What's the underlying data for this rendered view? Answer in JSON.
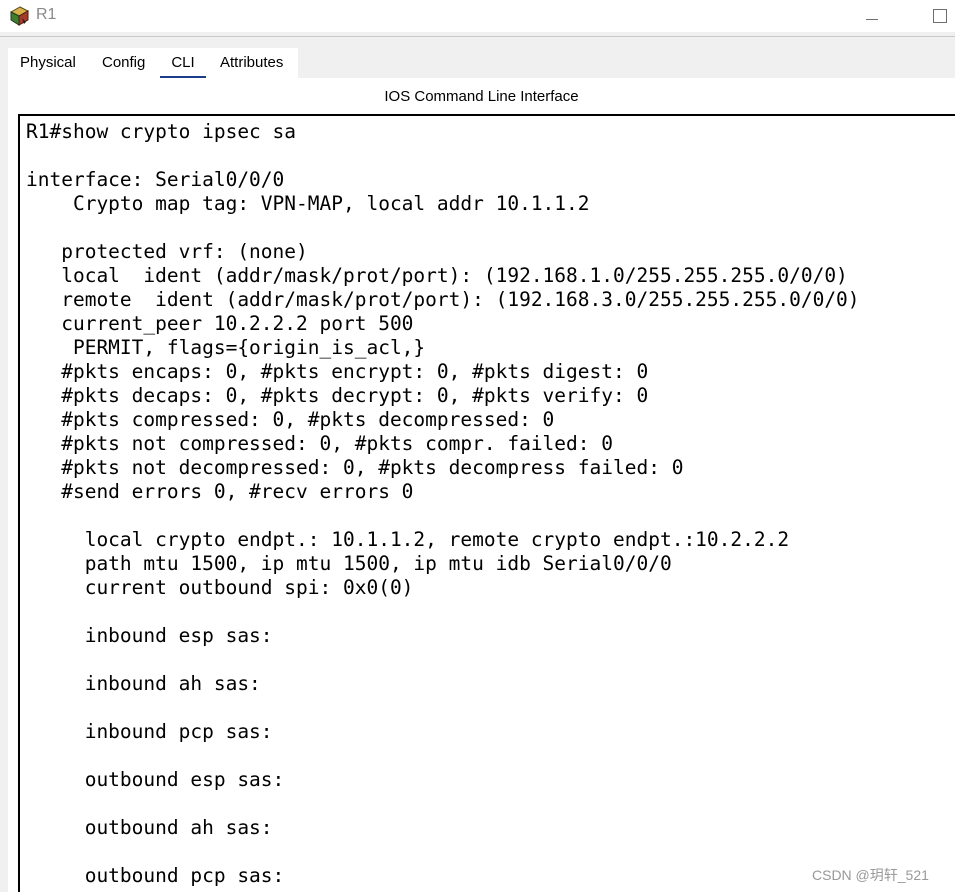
{
  "window": {
    "title": "R1",
    "icon": "router-app-icon"
  },
  "tabs": [
    {
      "label": "Physical",
      "active": false
    },
    {
      "label": "Config",
      "active": false
    },
    {
      "label": "CLI",
      "active": true
    },
    {
      "label": "Attributes",
      "active": false
    }
  ],
  "panel": {
    "title": "IOS Command Line Interface"
  },
  "terminal": {
    "lines": [
      "R1#show crypto ipsec sa",
      "",
      "interface: Serial0/0/0",
      "    Crypto map tag: VPN-MAP, local addr 10.1.1.2",
      "",
      "   protected vrf: (none)",
      "   local  ident (addr/mask/prot/port): (192.168.1.0/255.255.255.0/0/0)",
      "   remote  ident (addr/mask/prot/port): (192.168.3.0/255.255.255.0/0/0)",
      "   current_peer 10.2.2.2 port 500",
      "    PERMIT, flags={origin_is_acl,}",
      "   #pkts encaps: 0, #pkts encrypt: 0, #pkts digest: 0",
      "   #pkts decaps: 0, #pkts decrypt: 0, #pkts verify: 0",
      "   #pkts compressed: 0, #pkts decompressed: 0",
      "   #pkts not compressed: 0, #pkts compr. failed: 0",
      "   #pkts not decompressed: 0, #pkts decompress failed: 0",
      "   #send errors 0, #recv errors 0",
      "",
      "     local crypto endpt.: 10.1.1.2, remote crypto endpt.:10.2.2.2",
      "     path mtu 1500, ip mtu 1500, ip mtu idb Serial0/0/0",
      "     current outbound spi: 0x0(0)",
      "",
      "     inbound esp sas:",
      "",
      "     inbound ah sas:",
      "",
      "     inbound pcp sas:",
      "",
      "     outbound esp sas:",
      "",
      "     outbound ah sas:",
      "",
      "     outbound pcp sas:"
    ]
  },
  "watermark": "CSDN @玥轩_521"
}
